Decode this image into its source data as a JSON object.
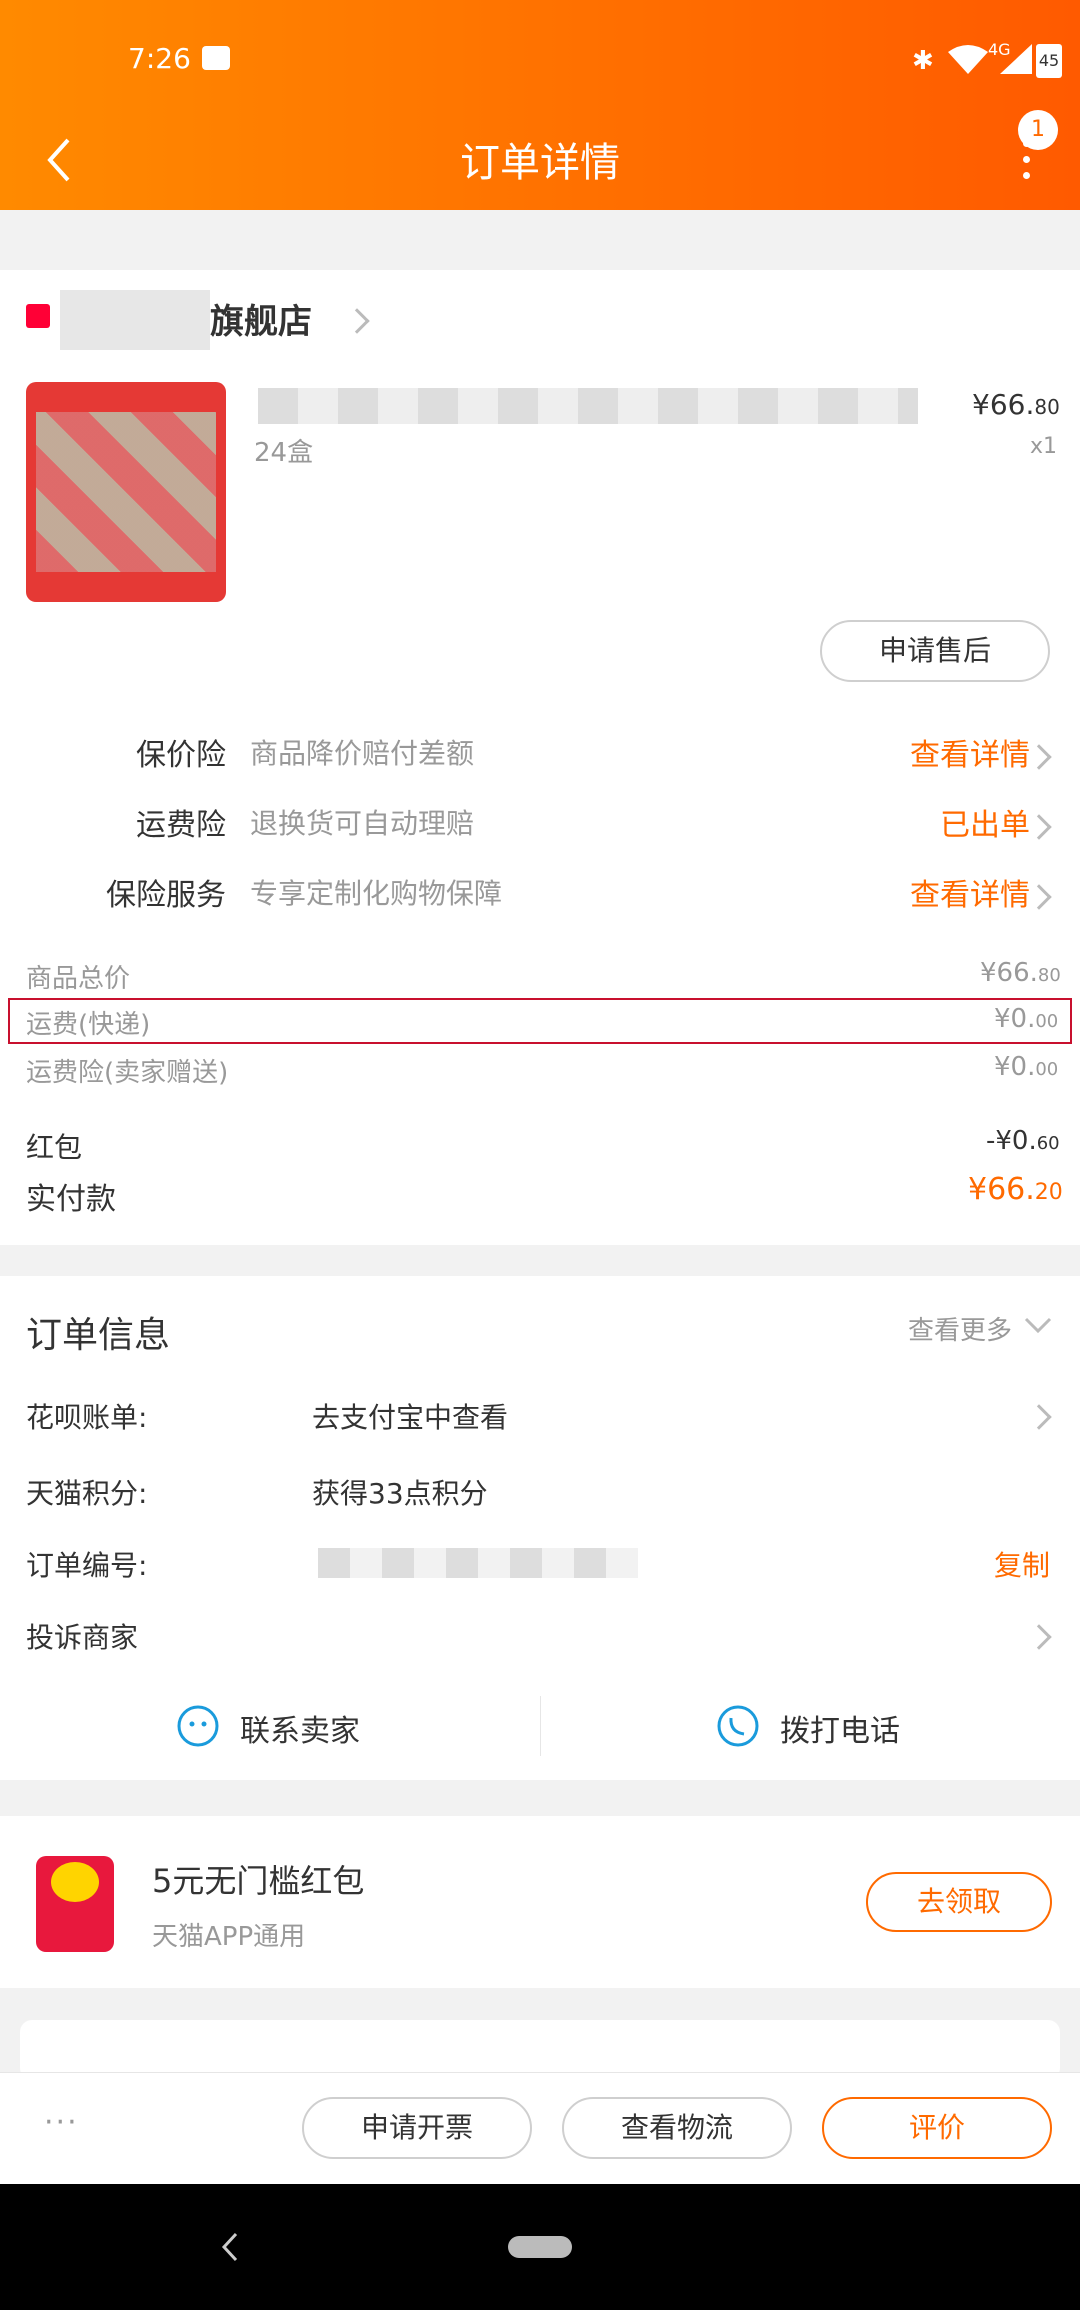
{
  "status": {
    "time": "7:26",
    "net": "4G",
    "battery": "45"
  },
  "header": {
    "title": "订单详情",
    "badge": "1"
  },
  "store": {
    "name": "旗舰店"
  },
  "product": {
    "spec": "24盒",
    "price_prefix": "¥66.",
    "price_decimal": "80",
    "qty": "x1",
    "after_sale_button": "申请售后"
  },
  "services": [
    {
      "label": "保价险",
      "desc": "商品降价赔付差额",
      "action": "查看详情"
    },
    {
      "label": "运费险",
      "desc": "退换货可自动理赔",
      "action": "已出单"
    },
    {
      "label": "保险服务",
      "desc": "专享定制化购物保障",
      "action": "查看详情"
    }
  ],
  "totals": {
    "goods_label": "商品总价",
    "goods_int": "¥66.",
    "goods_dec": "80",
    "shipping_label": "运费(快递)",
    "shipping_int": "¥0.",
    "shipping_dec": "00",
    "ship_ins_label": "运费险(卖家赠送)",
    "ship_ins_int": "¥0.",
    "ship_ins_dec": "00",
    "redpacket_label": "红包",
    "redpacket_int": "-¥0.",
    "redpacket_dec": "60",
    "paid_label": "实付款",
    "paid_int": "¥66.",
    "paid_dec": "20"
  },
  "order_info": {
    "title": "订单信息",
    "more": "查看更多",
    "huabei_label": "花呗账单:",
    "huabei_value": "去支付宝中查看",
    "points_label": "天猫积分:",
    "points_value": "获得33点积分",
    "order_no_label": "订单编号:",
    "copy": "复制",
    "complain": "投诉商家",
    "contact_seller": "联系卖家",
    "call": "拨打电话"
  },
  "promo": {
    "title": "5元无门槛红包",
    "subtitle": "天猫APP通用",
    "button": "去领取"
  },
  "footer": {
    "more": "···",
    "invoice": "申请开票",
    "logistics": "查看物流",
    "review": "评价"
  },
  "colors": {
    "accent": "#ff6a00",
    "highlight_box": "#c8102e"
  }
}
